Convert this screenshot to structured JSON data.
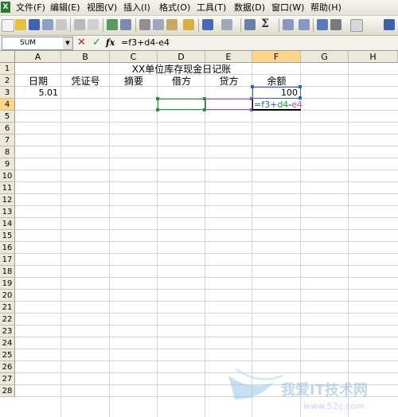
{
  "app": {
    "icon": "excel-icon"
  },
  "menu": [
    "文件(F)",
    "编辑(E)",
    "视图(V)",
    "插入(I)",
    "格式(O)",
    "工具(T)",
    "数据(D)",
    "窗口(W)",
    "帮助(H)"
  ],
  "formula_bar": {
    "name_box": "SUM",
    "formula": "=f3+d4-e4",
    "cancel": "✕",
    "enter": "✓",
    "fx": "fx"
  },
  "columns": [
    "A",
    "B",
    "C",
    "D",
    "E",
    "F",
    "G",
    "H"
  ],
  "rows": [
    "1",
    "2",
    "3",
    "4",
    "5",
    "6",
    "7",
    "8",
    "9",
    "10",
    "11",
    "12",
    "13",
    "14",
    "15",
    "16",
    "17",
    "18",
    "19",
    "20",
    "21",
    "22",
    "23",
    "24",
    "25",
    "26",
    "27",
    "28"
  ],
  "cells": {
    "title": "XX单位库存现金日记账",
    "hdr_date": "日期",
    "hdr_voucher": "凭证号",
    "hdr_summary": "摘要",
    "hdr_debit": "借方",
    "hdr_credit": "贷方",
    "hdr_balance": "余额",
    "a3": "5.01",
    "f3": "100"
  },
  "editing": {
    "p1": "=f3+",
    "p2": "d4",
    "p3": "-",
    "p4": "e4"
  },
  "watermark": {
    "text": "我爱IT技术网",
    "url": "www.52ij.com"
  },
  "colors": {
    "ref_d4": "#1e9a2a",
    "ref_e4": "#a04ad0",
    "ref_f3": "#2d5fc8",
    "active_header": "#ffd58a"
  }
}
